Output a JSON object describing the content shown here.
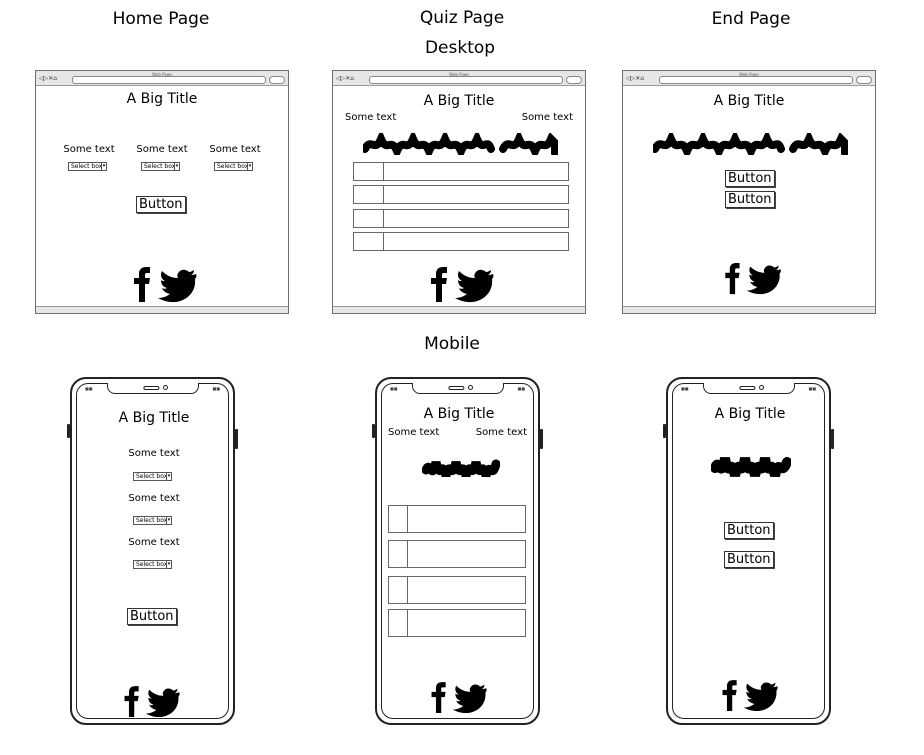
{
  "headers": {
    "home": "Home Page",
    "quiz": "Quiz Page",
    "end": "End Page",
    "desktop": "Desktop",
    "mobile": "Mobile"
  },
  "browser_tab": "Web Page",
  "title": "A Big Title",
  "some_text": "Some text",
  "select_placeholder": "Select box",
  "button_label": "Button",
  "social_icons": [
    "facebook-icon",
    "twitter-icon"
  ]
}
